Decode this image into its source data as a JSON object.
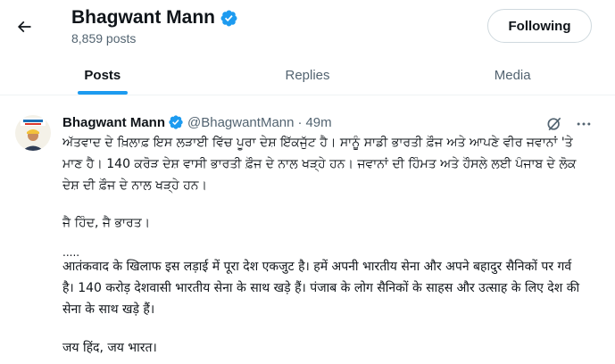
{
  "header": {
    "name": "Bhagwant Mann",
    "posts_count": "8,859 posts",
    "follow_button": "Following"
  },
  "tabs": [
    {
      "label": "Posts",
      "active": true
    },
    {
      "label": "Replies",
      "active": false
    },
    {
      "label": "Media",
      "active": false
    }
  ],
  "post": {
    "author_name": "Bhagwant Mann",
    "handle": "@BhagwantMann",
    "separator": "·",
    "time": "49m",
    "paragraphs": [
      "ਅੱਤਵਾਦ ਦੇ ਖ਼ਿਲਾਫ਼ ਇਸ ਲੜਾਈ ਵਿੱਚ ਪੂਰਾ ਦੇਸ਼ ਇੱਕਜੁੱਟ ਹੈ। ਸਾਨੂੰ ਸਾਡੀ ਭਾਰਤੀ ਫ਼ੌਜ ਅਤੇ ਆਪਣੇ ਵੀਰ ਜਵਾਨਾਂ 'ਤੇ ਮਾਣ ਹੈ। 140 ਕਰੋੜ ਦੇਸ਼ ਵਾਸੀ ਭਾਰਤੀ ਫ਼ੌਜ ਦੇ ਨਾਲ ਖੜ੍ਹੇ ਹਨ। ਜਵਾਨਾਂ ਦੀ ਹਿੰਮਤ ਅਤੇ ਹੌਸਲੇ ਲਈ ਪੰਜਾਬ ਦੇ ਲੋਕ ਦੇਸ਼ ਦੀ ਫ਼ੌਜ ਦੇ ਨਾਲ ਖੜ੍ਹੇ ਹਨ।",
      "ਜੈ ਹਿੰਦ, ਜੈ ਭਾਰਤ।",
      ".....",
      "आतंकवाद के खिलाफ इस लड़ाई में पूरा देश एकजुट है। हमें अपनी भारतीय सेना और अपने बहादुर सैनिकों पर गर्व है। 140 करोड़ देशवासी भारतीय सेना के साथ खड़े हैं। पंजाब के लोग सैनिकों के साहस और उत्साह के लिए देश की सेना के साथ खड़े हैं।",
      "जय हिंद, जय भारत।"
    ]
  },
  "icons": {
    "back": "arrow-left-icon",
    "verified": "verified-badge-icon",
    "grok": "grok-icon",
    "more": "more-horizontal-icon"
  },
  "colors": {
    "accent": "#1d9bf0",
    "text_primary": "#0f1419",
    "text_secondary": "#536471",
    "border": "#cfd9de"
  }
}
